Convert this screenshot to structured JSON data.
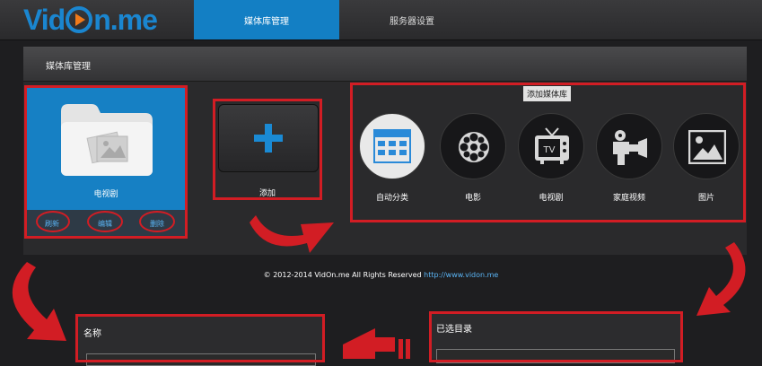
{
  "header": {
    "logo_text_left": "Vid",
    "logo_text_right": "n.me",
    "tabs": [
      {
        "label": "媒体库管理",
        "active": true
      },
      {
        "label": "服务器设置",
        "active": false
      }
    ]
  },
  "panel": {
    "title": "媒体库管理",
    "library": {
      "name": "电视剧",
      "actions": [
        "刷新",
        "编辑",
        "删除"
      ]
    },
    "add_button": {
      "label": "添加",
      "icon": "plus-icon"
    },
    "add_library": {
      "title": "添加媒体库",
      "types": [
        {
          "label": "自动分类",
          "icon": "grid-list-icon",
          "selected": true
        },
        {
          "label": "电影",
          "icon": "film-reel-icon",
          "selected": false
        },
        {
          "label": "电视剧",
          "icon": "tv-icon",
          "selected": false
        },
        {
          "label": "家庭视频",
          "icon": "camcorder-icon",
          "selected": false
        },
        {
          "label": "图片",
          "icon": "picture-icon",
          "selected": false
        }
      ]
    }
  },
  "footer": {
    "copyright": "© 2012-2014 VidOn.me All Rights Reserved ",
    "link": "http://www.vidon.me"
  },
  "name_panel": {
    "label": "名称"
  },
  "selected_dir_panel": {
    "label": "已选目录"
  },
  "colors": {
    "accent_blue": "#137fc4",
    "annotation_red": "#d21d24"
  }
}
